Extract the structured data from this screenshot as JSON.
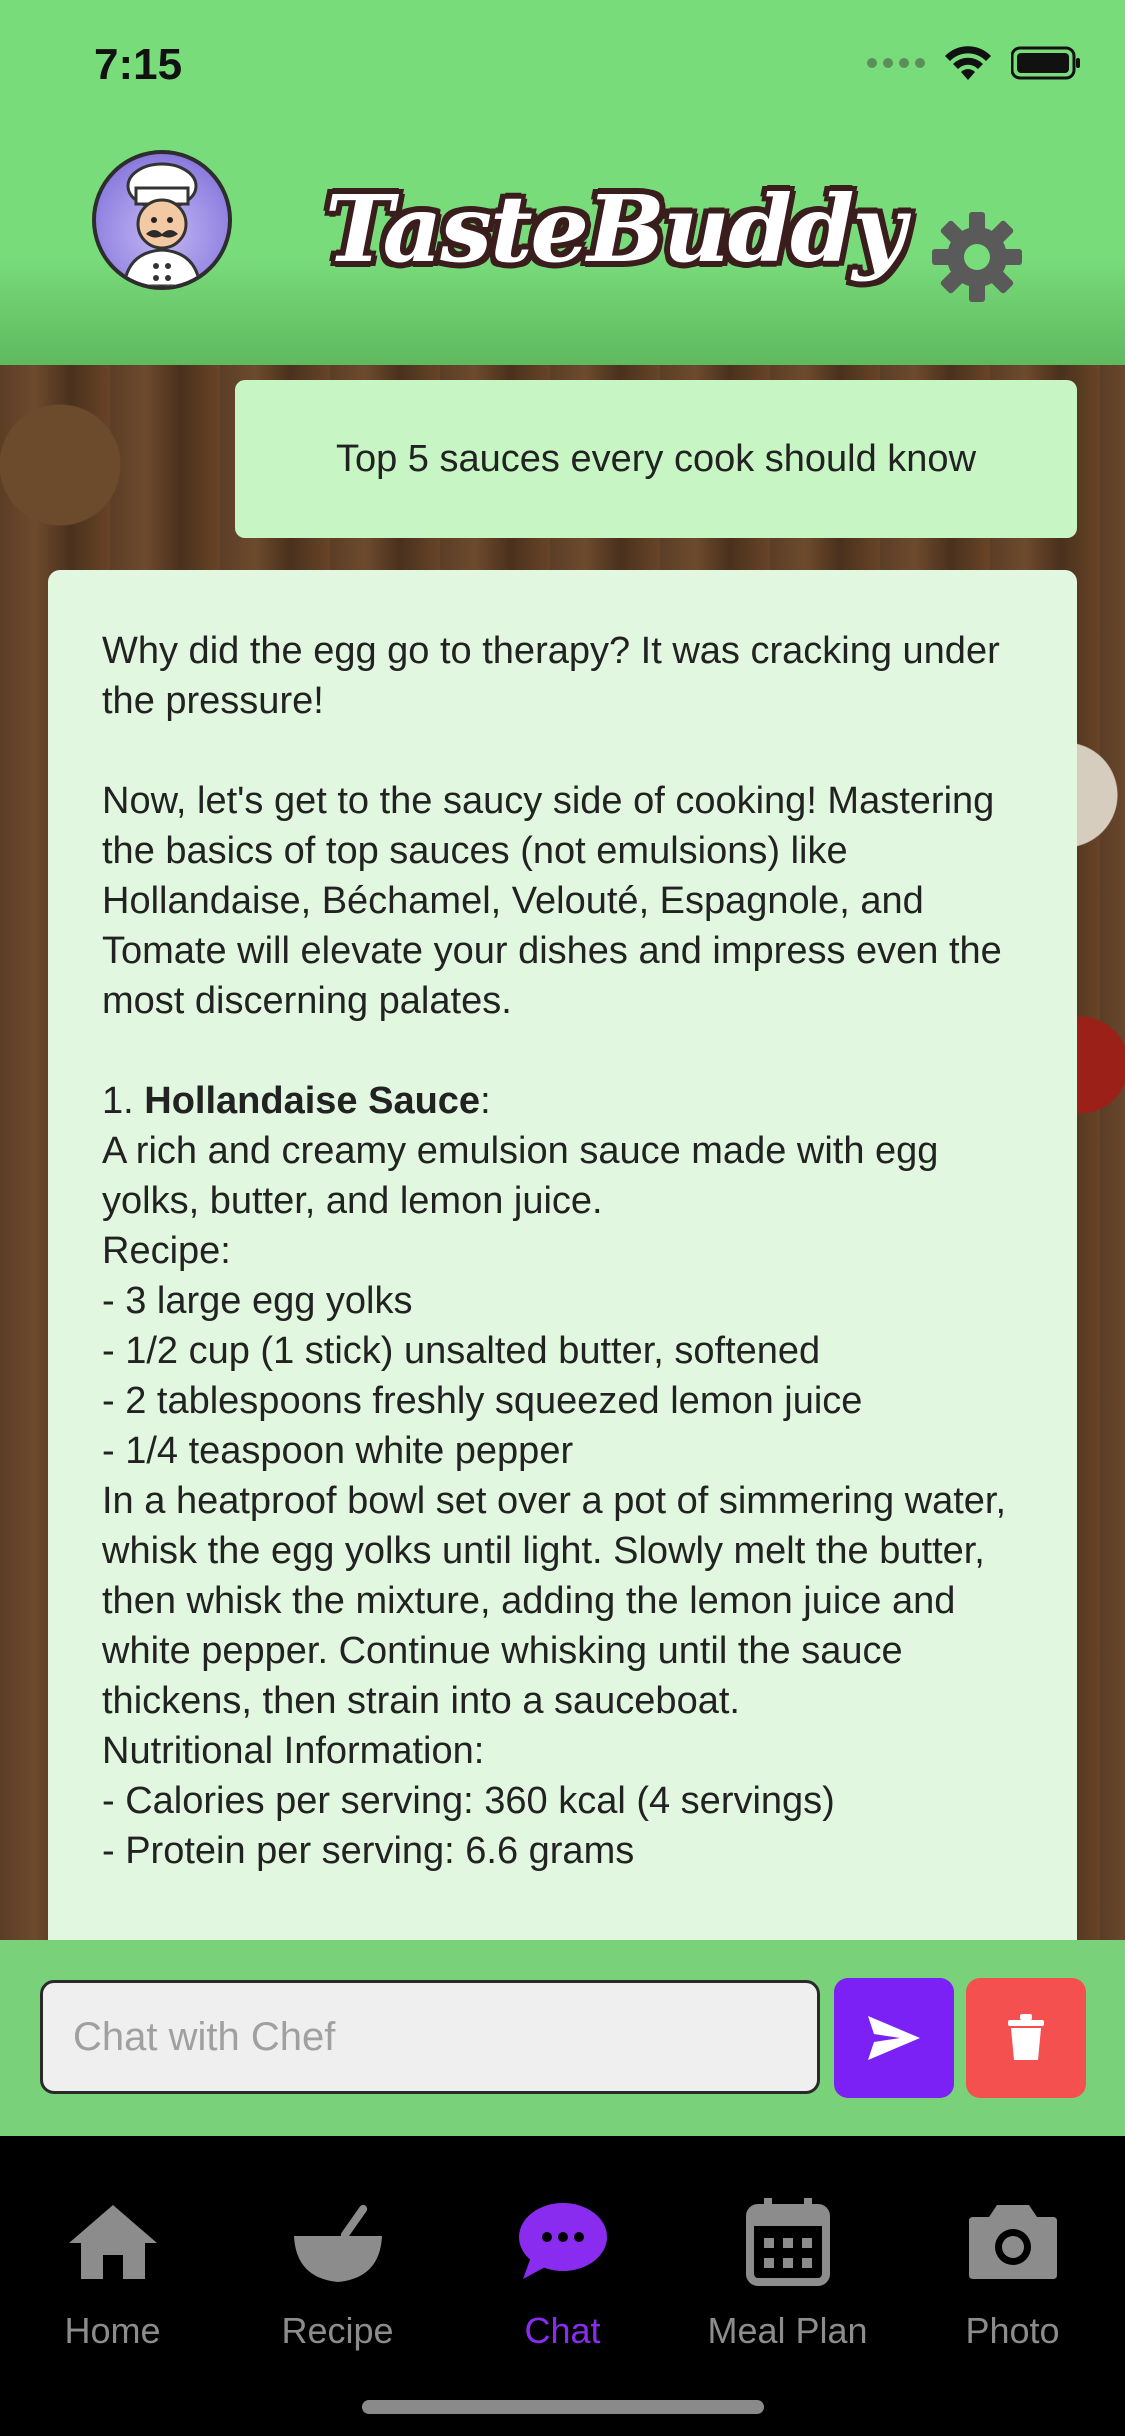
{
  "status_bar": {
    "time": "7:15"
  },
  "header": {
    "brand": "TasteBuddy",
    "settings_icon": "gear-icon",
    "avatar": "chef-avatar"
  },
  "chat": {
    "user_message": "Top 5 sauces every cook should know",
    "bot_message": {
      "joke": "Why did the egg go to therapy? It was cracking under the pressure!",
      "intro": "Now, let's get to the saucy side of cooking! Mastering the basics of top sauces (not emulsions) like Hollandaise, Béchamel, Velouté, Espagnole, and Tomate will elevate your dishes and impress even the most discerning palates.",
      "item1_number": "1.",
      "item1_title": "Hollandaise Sauce",
      "item1_colon": ":",
      "item1_desc": "A rich and creamy emulsion sauce made with egg yolks, butter, and lemon juice.",
      "recipe_label": "Recipe:",
      "ingredients": [
        "- 3 large egg yolks",
        "- 1/2 cup (1 stick) unsalted butter, softened",
        "- 2 tablespoons freshly squeezed lemon juice",
        "- 1/4 teaspoon white pepper"
      ],
      "method": "In a heatproof bowl set over a pot of simmering water, whisk the egg yolks until light. Slowly melt the butter, then whisk the mixture, adding the lemon juice and white pepper. Continue whisking until the sauce thickens, then strain into a sauceboat.",
      "nutrition_label": "Nutritional Information:",
      "nutrition": [
        "- Calories per serving: 360 kcal (4 servings)",
        "- Protein per serving: 6.6 grams"
      ]
    }
  },
  "input": {
    "placeholder": "Chat with Chef",
    "send_icon": "send-icon",
    "delete_icon": "trash-icon"
  },
  "tabs": [
    {
      "label": "Home",
      "icon": "home-icon",
      "active": false
    },
    {
      "label": "Recipe",
      "icon": "bowl-icon",
      "active": false
    },
    {
      "label": "Chat",
      "icon": "chat-bubble-icon",
      "active": true
    },
    {
      "label": "Meal Plan",
      "icon": "calendar-icon",
      "active": false
    },
    {
      "label": "Photo",
      "icon": "camera-icon",
      "active": false
    }
  ],
  "colors": {
    "header_green": "#79dc7b",
    "user_bubble": "#c7f5c4",
    "bot_bubble": "#e2f7e0",
    "send_button": "#7b21f5",
    "delete_button": "#f45050",
    "active_tab": "#8a2cf0"
  }
}
